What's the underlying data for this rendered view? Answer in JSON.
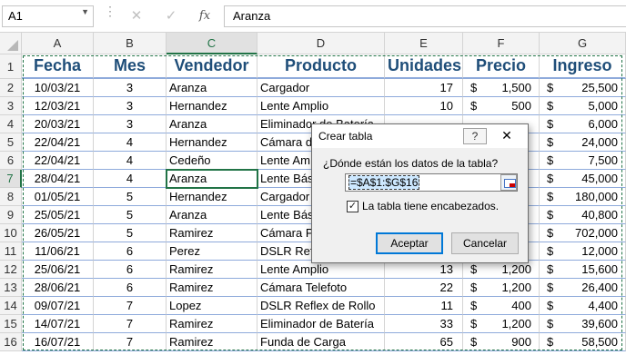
{
  "formula_bar": {
    "name_box": "A1",
    "value": "Aranza",
    "fx_label": "fx",
    "cancel_icon": "close-icon",
    "enter_icon": "check-icon"
  },
  "columns": [
    "A",
    "B",
    "C",
    "D",
    "E",
    "F",
    "G"
  ],
  "rows": [
    "1",
    "2",
    "3",
    "4",
    "5",
    "6",
    "7",
    "8",
    "9",
    "10",
    "11",
    "12",
    "13",
    "14",
    "15",
    "16"
  ],
  "headers": [
    "Fecha",
    "Mes",
    "Vendedor",
    "Producto",
    "Unidades",
    "Precio",
    "Ingreso"
  ],
  "data": [
    [
      "10/03/21",
      "3",
      "Aranza",
      "Cargador",
      "17",
      "1,500",
      "25,500"
    ],
    [
      "12/03/21",
      "3",
      "Hernandez",
      "Lente Amplio",
      "10",
      "500",
      "5,000"
    ],
    [
      "20/03/21",
      "3",
      "Aranza",
      "Eliminador de Batería",
      "",
      "",
      "6,000"
    ],
    [
      "22/04/21",
      "4",
      "Hernandez",
      "Cámara de",
      "",
      "",
      "24,000"
    ],
    [
      "22/04/21",
      "4",
      "Cedeño",
      "Lente Am",
      "",
      "",
      "7,500"
    ],
    [
      "28/04/21",
      "4",
      "Aranza",
      "Lente Bás",
      "",
      "",
      "45,000"
    ],
    [
      "01/05/21",
      "5",
      "Hernandez",
      "Cargador",
      "",
      "",
      "180,000"
    ],
    [
      "25/05/21",
      "5",
      "Aranza",
      "Lente Bás",
      "",
      "",
      "40,800"
    ],
    [
      "26/05/21",
      "5",
      "Ramirez",
      "Cámara P",
      "",
      "",
      "702,000"
    ],
    [
      "11/06/21",
      "6",
      "Perez",
      "DSLR Refl",
      "",
      "",
      "12,000"
    ],
    [
      "25/06/21",
      "6",
      "Ramirez",
      "Lente Amplio",
      "13",
      "1,200",
      "15,600"
    ],
    [
      "28/06/21",
      "6",
      "Ramirez",
      "Cámara Telefoto",
      "22",
      "1,200",
      "26,400"
    ],
    [
      "09/07/21",
      "7",
      "Lopez",
      "DSLR Reflex de Rollo",
      "11",
      "400",
      "4,400"
    ],
    [
      "14/07/21",
      "7",
      "Ramirez",
      "Eliminador de Batería",
      "33",
      "1,200",
      "39,600"
    ],
    [
      "16/07/21",
      "7",
      "Ramirez",
      "Funda de Carga",
      "65",
      "900",
      "58,500"
    ]
  ],
  "currency_symbol": "$",
  "dialog": {
    "title": "Crear tabla",
    "help": "?",
    "close": "✕",
    "prompt": "¿Dónde están los datos de la tabla?",
    "range": "=$A$1:$G$16",
    "checkbox_checked": true,
    "checkbox_label": "La tabla tiene encabezados.",
    "ok": "Aceptar",
    "cancel": "Cancelar"
  },
  "colors": {
    "accent": "#217346",
    "header_text": "#1f4e79",
    "dialog_default_border": "#0078d7"
  }
}
